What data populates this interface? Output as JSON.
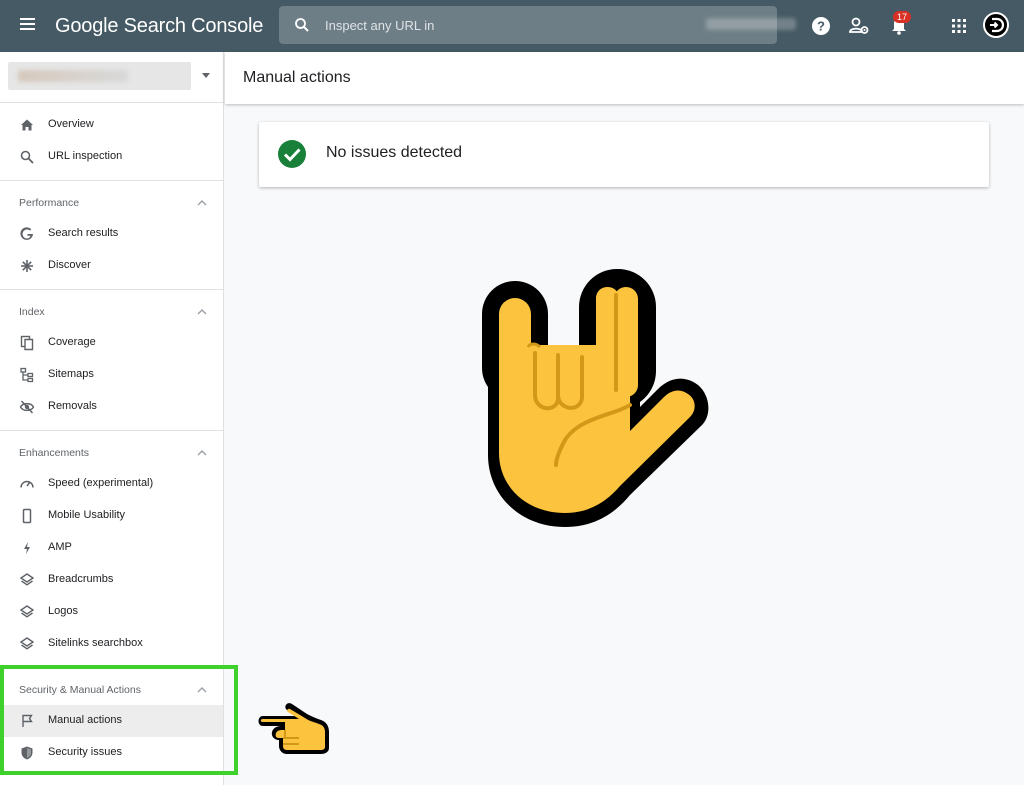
{
  "app": {
    "title": "Google Search Console"
  },
  "search": {
    "placeholder": "Inspect any URL in"
  },
  "header_icons": [
    "help-icon",
    "manage-users-icon",
    "notifications-icon",
    "apps-icon",
    "account-avatar"
  ],
  "notifications": {
    "count": "17"
  },
  "sidebar": {
    "top_items": [
      {
        "label": "Overview",
        "icon": "home-icon"
      },
      {
        "label": "URL inspection",
        "icon": "search-icon"
      }
    ],
    "sections": [
      {
        "title": "Performance",
        "items": [
          {
            "label": "Search results",
            "icon": "google-g-icon"
          },
          {
            "label": "Discover",
            "icon": "asterisk-icon"
          }
        ]
      },
      {
        "title": "Index",
        "items": [
          {
            "label": "Coverage",
            "icon": "copy-pages-icon"
          },
          {
            "label": "Sitemaps",
            "icon": "sitemap-icon"
          },
          {
            "label": "Removals",
            "icon": "eye-off-icon"
          }
        ]
      },
      {
        "title": "Enhancements",
        "items": [
          {
            "label": "Speed (experimental)",
            "icon": "speedometer-icon"
          },
          {
            "label": "Mobile Usability",
            "icon": "phone-icon"
          },
          {
            "label": "AMP",
            "icon": "bolt-icon"
          },
          {
            "label": "Breadcrumbs",
            "icon": "layers-icon"
          },
          {
            "label": "Logos",
            "icon": "layers-icon"
          },
          {
            "label": "Sitelinks searchbox",
            "icon": "layers-icon"
          }
        ]
      },
      {
        "title": "Security & Manual Actions",
        "items": [
          {
            "label": "Manual actions",
            "icon": "flag-icon",
            "active": true
          },
          {
            "label": "Security issues",
            "icon": "shield-icon"
          }
        ]
      }
    ]
  },
  "main": {
    "page_title": "Manual actions",
    "status_message": "No issues detected"
  },
  "colors": {
    "topbar": "#455a64",
    "success_green": "#188038",
    "highlight_green": "#3ed12b",
    "emoji_yellow": "#fcc43e"
  }
}
